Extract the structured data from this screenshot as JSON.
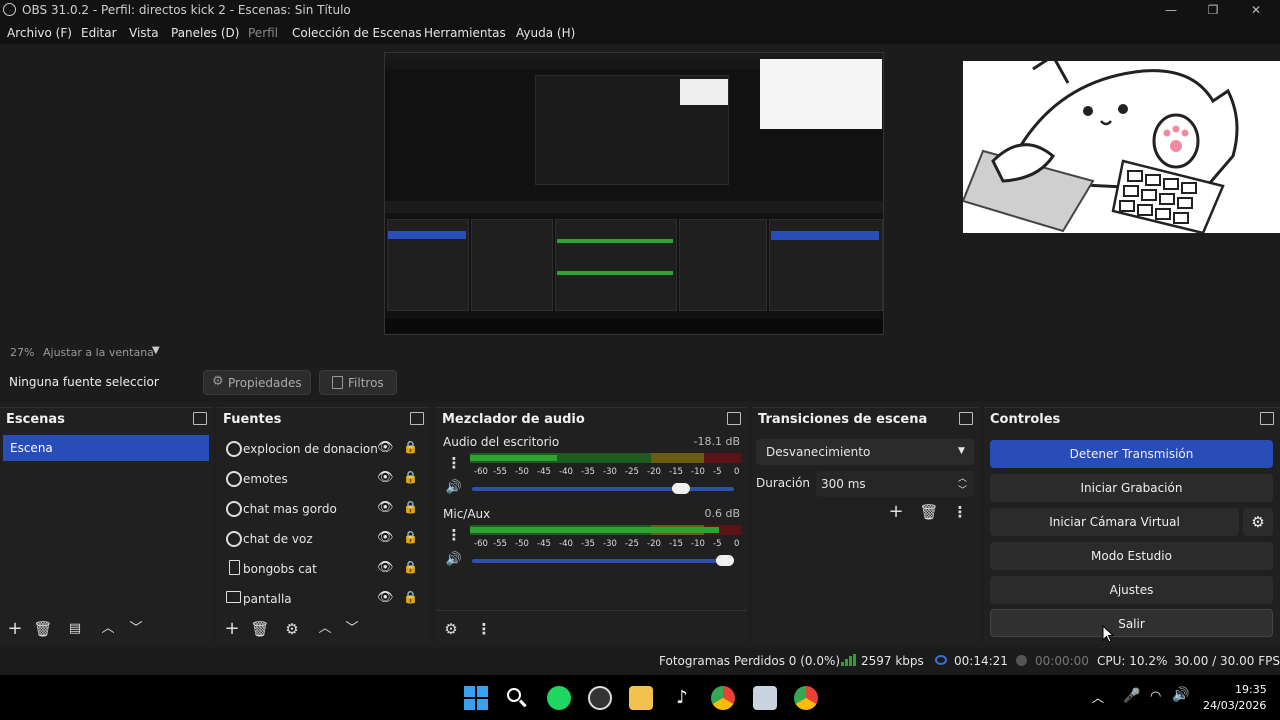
{
  "window": {
    "title": "OBS 31.0.2 - Perfil: directos kick 2 - Escenas: Sin Título"
  },
  "menu": [
    "Archivo (F)",
    "Editar",
    "Vista",
    "Paneles (D)",
    "Perfil",
    "Colección de Escenas",
    "Herramientas",
    "Ayuda (H)"
  ],
  "preview": {
    "zoom": "27%",
    "fit_label": "Ajustar a la ventana"
  },
  "source_bar": {
    "selection": "Ninguna fuente seleccionada",
    "properties": "Propiedades",
    "filters": "Filtros"
  },
  "scenes": {
    "title": "Escenas",
    "items": [
      "Escena"
    ]
  },
  "sources": {
    "title": "Fuentes",
    "items": [
      {
        "label": "explocion de donaciones",
        "icon": "globe-icon"
      },
      {
        "label": "emotes",
        "icon": "globe-icon"
      },
      {
        "label": "chat mas gordo",
        "icon": "globe-icon"
      },
      {
        "label": "chat de voz",
        "icon": "globe-icon"
      },
      {
        "label": "bongobs cat",
        "icon": "file-icon"
      },
      {
        "label": "pantalla",
        "icon": "monitor-icon"
      }
    ]
  },
  "mixer": {
    "title": "Mezclador de audio",
    "channels": [
      {
        "name": "Audio del escritorio",
        "db": "-18.1 dB",
        "level": 0.32,
        "fader": 0.82
      },
      {
        "name": "Mic/Aux",
        "db": "0.6 dB",
        "level": 0.92,
        "fader": 1.0
      }
    ],
    "scale": [
      "-60",
      "-55",
      "-50",
      "-45",
      "-40",
      "-35",
      "-30",
      "-25",
      "-20",
      "-15",
      "-10",
      "-5",
      "0"
    ]
  },
  "transitions": {
    "title": "Transiciones de escena",
    "selected": "Desvanecimiento",
    "duration_label": "Duración",
    "duration_value": "300 ms"
  },
  "controls": {
    "title": "Controles",
    "stop_stream": "Detener Transmisión",
    "start_recording": "Iniciar Grabación",
    "start_virtual_cam": "Iniciar Cámara Virtual",
    "studio_mode": "Modo Estudio",
    "settings": "Ajustes",
    "exit": "Salir"
  },
  "status": {
    "dropped_frames": "Fotogramas Perdidos 0 (0.0%)",
    "bitrate": "2597 kbps",
    "stream_time": "00:14:21",
    "rec_time": "00:00:00",
    "cpu": "CPU: 10.2%",
    "fps": "30.00 / 30.00 FPS"
  },
  "taskbar": {
    "time": "19:35",
    "date": "24/03/2026"
  },
  "colors": {
    "accent": "#284cb8",
    "meter_green": "#2fa32f",
    "meter_yellow": "#c5a516",
    "meter_red": "#b3222a"
  }
}
